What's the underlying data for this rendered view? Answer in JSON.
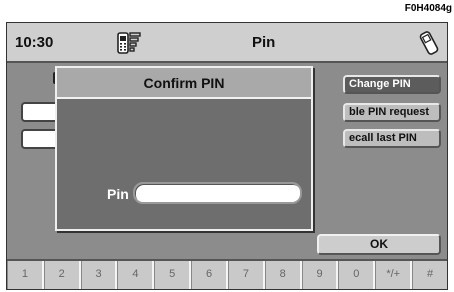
{
  "figure_ref": "F0H4084g",
  "titlebar": {
    "time": "10:30",
    "title": "Pin",
    "signal_icon": "phone-signal-icon",
    "handset_icon": "handset-icon"
  },
  "side_buttons": [
    {
      "label": "Change PIN",
      "active": true
    },
    {
      "label": "ble PIN request",
      "active": false
    },
    {
      "label": "ecall last PIN",
      "active": false
    }
  ],
  "dialog": {
    "title": "Confirm PIN",
    "pin_label": "Pin",
    "pin_value": ""
  },
  "ok_button": {
    "label": "OK"
  },
  "keys": [
    "1",
    "2",
    "3",
    "4",
    "5",
    "6",
    "7",
    "8",
    "9",
    "0",
    "*/+",
    "#"
  ]
}
